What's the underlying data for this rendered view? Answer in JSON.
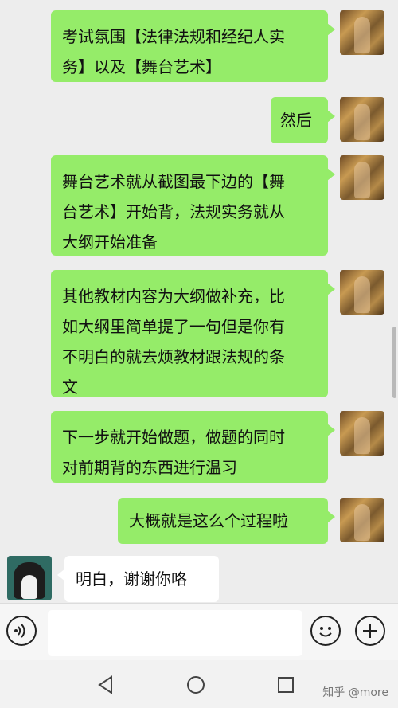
{
  "messages": [
    {
      "side": "out",
      "text": "考试氛围【法律法规和经纪人实\n务】以及【舞台艺术】"
    },
    {
      "side": "out",
      "text": "然后"
    },
    {
      "side": "out",
      "text": "舞台艺术就从截图最下边的【舞\n台艺术】开始背，法规实务就从\n大纲开始准备"
    },
    {
      "side": "out",
      "text": "其他教材内容为大纲做补充，比\n如大纲里简单提了一句但是你有\n不明白的就去烦教材跟法规的条\n文"
    },
    {
      "side": "out",
      "text": "下一步就开始做题，做题的同时\n对前期背的东西进行温习"
    },
    {
      "side": "out",
      "text": "大概就是这么个过程啦"
    },
    {
      "side": "in",
      "text": "明白，谢谢你咯"
    }
  ],
  "input": {
    "value": "",
    "placeholder": ""
  },
  "icons": {
    "voice": "voice-icon",
    "emoji": "emoji-icon",
    "plus": "plus-icon",
    "back": "back-icon",
    "home": "home-icon",
    "recent": "recent-apps-icon"
  },
  "watermark": "知乎 @more",
  "colors": {
    "out_bubble": "#95ec69",
    "in_bubble": "#ffffff",
    "background": "#ededed"
  }
}
